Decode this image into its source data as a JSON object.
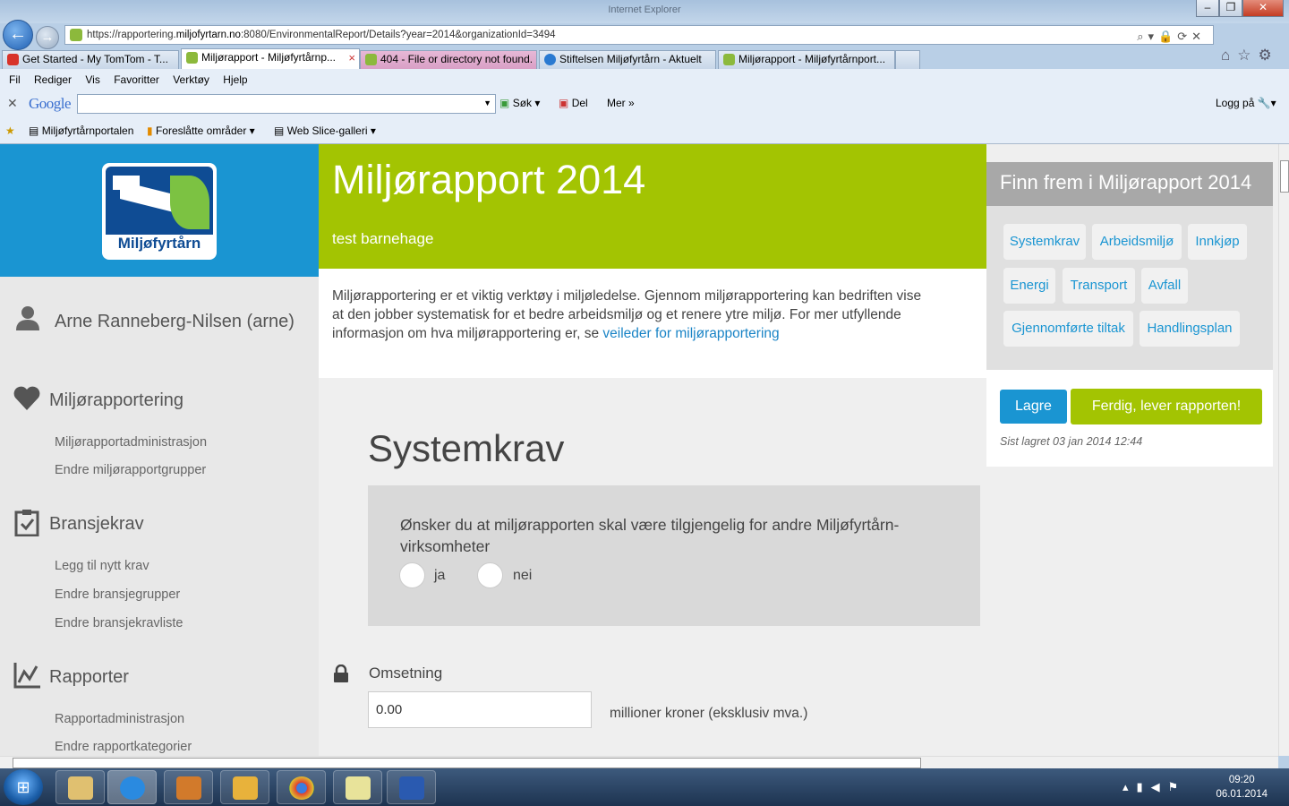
{
  "window": {
    "title": "Internet Explorer",
    "minimize": "–",
    "maximize": "❐",
    "close": "✕"
  },
  "address": {
    "prefix": "https://rapportering.",
    "domain": "miljofyrtarn.no",
    "suffix": ":8080/EnvironmentalReport/Details?year=2014&organizationId=3494"
  },
  "tabs": [
    {
      "label": "Get Started - My TomTom - T..."
    },
    {
      "label": "Miljørapport - Miljøfyrtårnp..."
    },
    {
      "label": "404 - File or directory not found."
    },
    {
      "label": "Stiftelsen Miljøfyrtårn - Aktuelt"
    },
    {
      "label": "Miljørapport - Miljøfyrtårnport..."
    }
  ],
  "menu": [
    "Fil",
    "Rediger",
    "Vis",
    "Favoritter",
    "Verktøy",
    "Hjelp"
  ],
  "google": {
    "logo": "Google",
    "search_label": "Søk",
    "share_label": "Del",
    "more_label": "Mer",
    "login_label": "Logg på"
  },
  "favorites": [
    "Miljøfyrtårnportalen",
    "Foreslåtte områder",
    "Web Slice-galleri"
  ],
  "sidebar": {
    "logo_text": "Miljøfyrtårn",
    "user": "Arne Ranneberg-Nilsen (arne)",
    "sections": [
      {
        "label": "Miljørapportering",
        "links": [
          "Miljørapportadministrasjon",
          "Endre miljørapportgrupper"
        ]
      },
      {
        "label": "Bransjekrav",
        "links": [
          "Legg til nytt krav",
          "Endre bransjegrupper",
          "Endre bransjekravliste"
        ]
      },
      {
        "label": "Rapporter",
        "links": [
          "Rapportadministrasjon",
          "Endre rapportkategorier"
        ]
      }
    ]
  },
  "header": {
    "title": "Miljørapport 2014",
    "subtitle": "test barnehage"
  },
  "intro": {
    "text": "Miljørapportering er et viktig verktøy i miljøledelse. Gjennom miljørapportering kan bedriften vise at den jobber systematisk for et bedre arbeidsmiljø og et renere ytre miljø. For mer utfyllende informasjon om hva miljørapportering er, se ",
    "link": "veileder for miljørapportering"
  },
  "main": {
    "section_title": "Systemkrav",
    "question": "Ønsker du at miljørapporten skal være tilgjengelig for andre Miljøfyrtårn-virksomheter",
    "option_yes": "ja",
    "option_no": "nei",
    "revenue_label": "Omsetning",
    "revenue_value": "0.00",
    "revenue_unit": "millioner kroner (eksklusiv mva.)"
  },
  "right": {
    "title": "Finn frem i Miljørapport 2014",
    "nav": [
      "Systemkrav",
      "Arbeidsmiljø",
      "Innkjøp",
      "Energi",
      "Transport",
      "Avfall",
      "Gjennomførte tiltak",
      "Handlingsplan"
    ],
    "save": "Lagre",
    "submit": "Ferdig, lever rapporten!",
    "last_saved": "Sist lagret 03 jan 2014 12:44"
  },
  "taskbar": {
    "time": "09:20",
    "date": "06.01.2014"
  },
  "colors": {
    "brand_blue": "#1a95d2",
    "brand_green": "#a3c402"
  }
}
